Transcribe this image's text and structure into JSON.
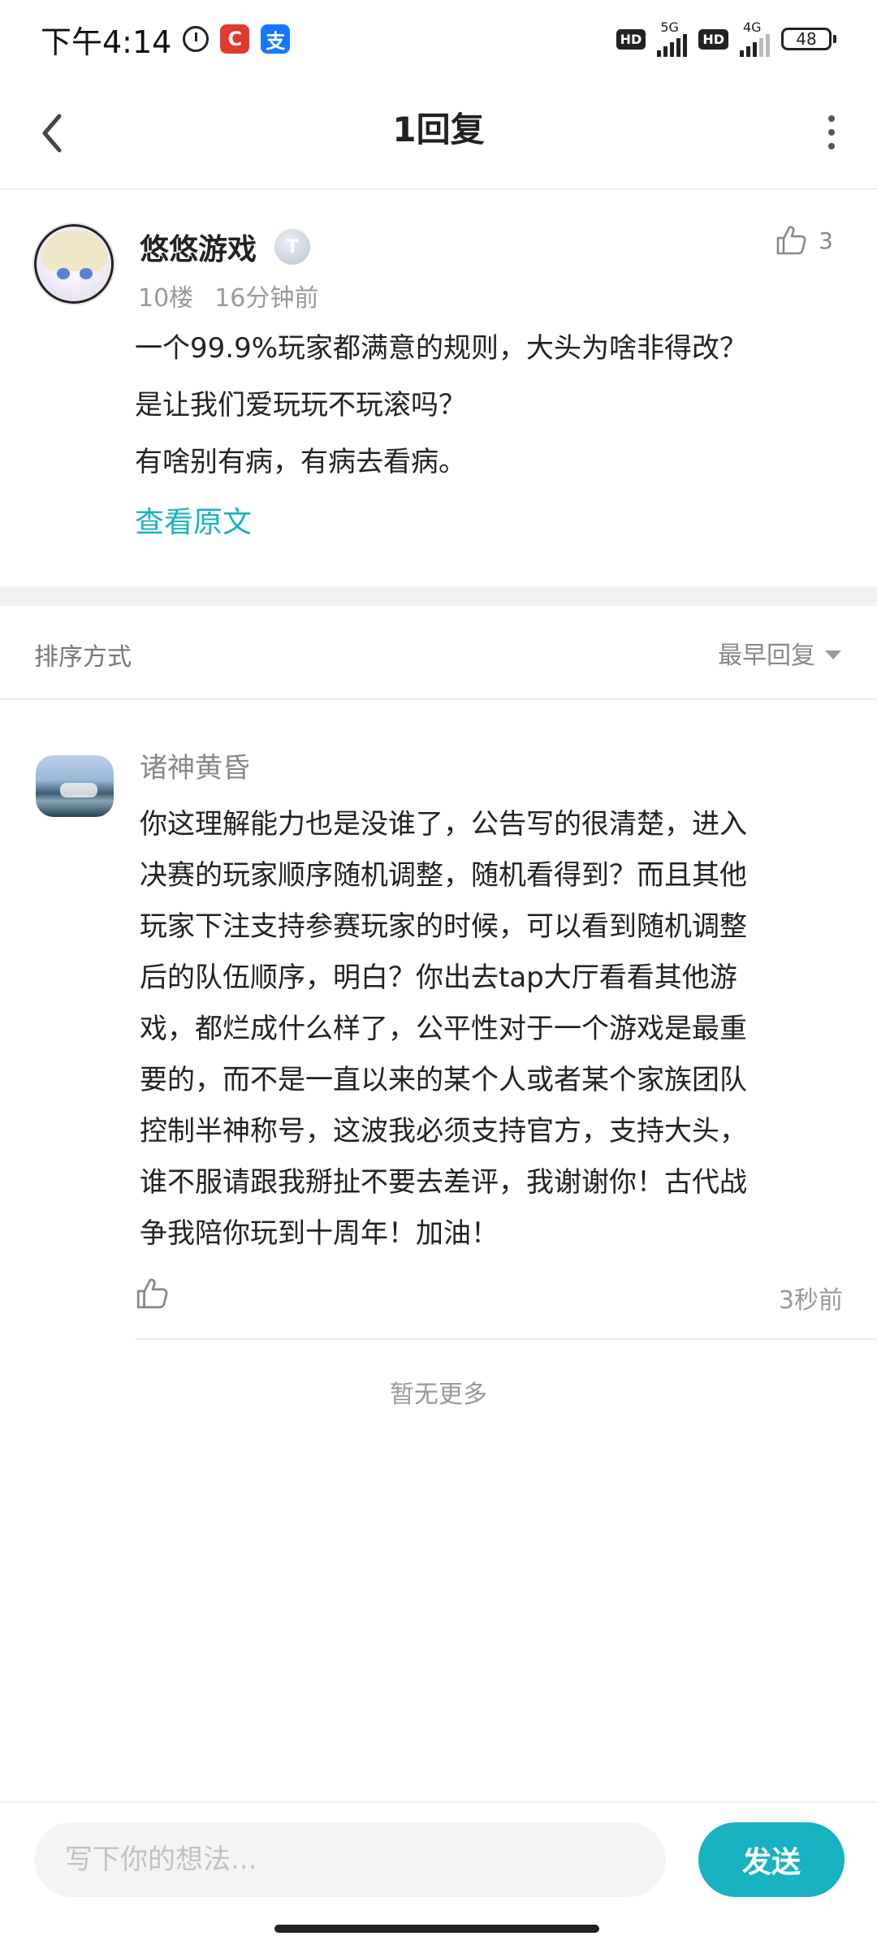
{
  "status_bar": {
    "time": "下午4:14",
    "network_1": "5G",
    "network_2": "4G",
    "hd_label": "HD",
    "battery": "48",
    "app_c_label": "C",
    "app_pay_label": "支"
  },
  "header": {
    "title": "1回复"
  },
  "main_post": {
    "author": "悠悠游戏",
    "badge": "T",
    "likes": "3",
    "floor": "10楼",
    "time": "16分钟前",
    "lines": [
      "一个99.9%玩家都满意的规则，大头为啥非得改？",
      "是让我们爱玩玩不玩滚吗？",
      "有啥别有病，有病去看病。"
    ],
    "view_original": "查看原文"
  },
  "sort": {
    "label": "排序方式",
    "selected": "最早回复"
  },
  "reply": {
    "author": "诸神黄昏",
    "lines": [
      "你这理解能力也是没谁了，公告写的很清楚，进入",
      "决赛的玩家顺序随机调整，随机看得到？而且其他",
      "玩家下注支持参赛玩家的时候，可以看到随机调整",
      "后的队伍顺序，明白？你出去tap大厅看看其他游",
      "戏，都烂成什么样了，公平性对于一个游戏是最重",
      "要的，而不是一直以来的某个人或者某个家族团队",
      "控制半神称号，这波我必须支持官方，支持大头，",
      "谁不服请跟我掰扯不要去差评，我谢谢你！古代战",
      "争我陪你玩到十周年！加油！"
    ],
    "time": "3秒前"
  },
  "footer_note": "暂无更多",
  "composer": {
    "placeholder": "写下你的想法...",
    "send_label": "发送"
  },
  "colors": {
    "accent": "#19b2c0",
    "muted_text": "#999999"
  }
}
